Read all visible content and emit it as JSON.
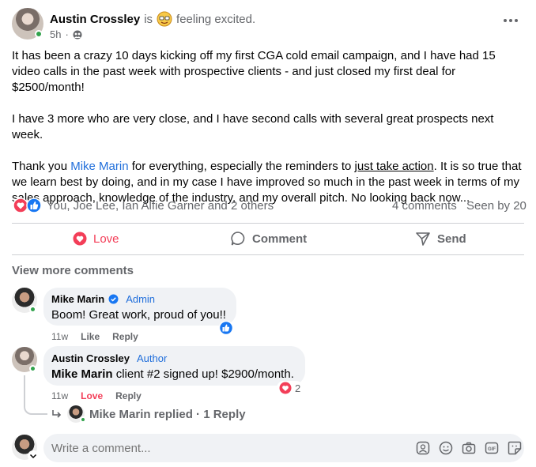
{
  "post": {
    "author": "Austin Crossley",
    "is_word": "is",
    "feeling": "feeling excited.",
    "time": "5h",
    "paragraphs": {
      "p1": "It has been a crazy 10 days kicking off my first CGA cold email campaign, and I have had 15 video calls in the past week with prospective clients - and just closed my first deal for $2500/month!",
      "p2": "I have 3 more who are very close, and I have second calls with several great prospects next week.",
      "p3_a": "Thank you ",
      "p3_mention": "Mike Marin",
      "p3_b": " for everything, especially the reminders to ",
      "p3_link": "just take action",
      "p3_c": ". It is so true that we learn best by doing, and in my case I have improved so much in the past week in terms of my sales approach, knowledge of the industry, and my overall pitch. No looking back now..."
    },
    "reactions_text": "You, Joe Lee, Ian Alfie Garner and 2 others",
    "comments_count": "4 comments",
    "seen_by": "Seen by 20"
  },
  "actions": {
    "love": "Love",
    "comment": "Comment",
    "send": "Send"
  },
  "comments": {
    "view_more": "View more comments",
    "c1": {
      "name": "Mike Marin",
      "badge": "Admin",
      "text": "Boom! Great work, proud of you!!",
      "time": "11w",
      "like": "Like",
      "reply": "Reply"
    },
    "c2": {
      "name": "Austin Crossley",
      "badge": "Author",
      "mention": "Mike Marin",
      "text": " client #2 signed up! $2900/month.",
      "time": "11w",
      "love": "Love",
      "reply": "Reply",
      "reaction_count": "2",
      "replied_name": "Mike Marin",
      "replied_text": "replied · 1 Reply"
    },
    "write_placeholder": "Write a comment..."
  },
  "colors": {
    "love_red": "#f33e58",
    "like_blue": "#1877f2",
    "online_green": "#31a24c",
    "mention_blue": "#216fdb"
  }
}
